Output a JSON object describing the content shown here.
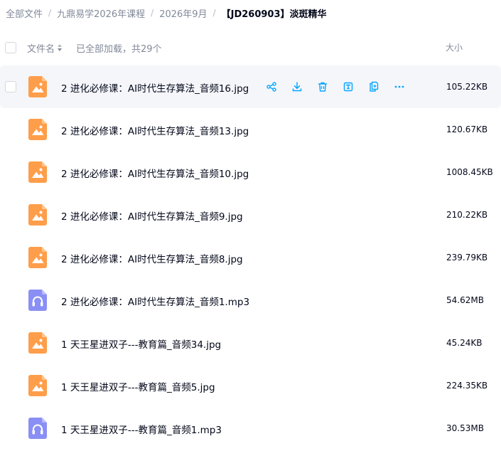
{
  "breadcrumb": [
    "全部文件",
    "九鼎易学2026年课程",
    "2026年9月",
    "【JD260903】淡斑精华"
  ],
  "header": {
    "name_label": "文件名",
    "loaded_info": "已全部加载，共29个",
    "size_label": "大小"
  },
  "colors": {
    "accent": "#06a7ff",
    "image_icon": "#ff9e4a",
    "audio_icon": "#8a8ff5",
    "text_primary": "#03081a",
    "text_secondary": "#818999"
  },
  "files": [
    {
      "name": "2 进化必修课：AI时代生存算法_音频16.jpg",
      "size": "105.22KB",
      "type": "image",
      "icon": "image-file-icon"
    },
    {
      "name": "2 进化必修课：AI时代生存算法_音频13.jpg",
      "size": "120.67KB",
      "type": "image",
      "icon": "image-file-icon"
    },
    {
      "name": "2 进化必修课：AI时代生存算法_音频10.jpg",
      "size": "1008.45KB",
      "type": "image",
      "icon": "image-file-icon"
    },
    {
      "name": "2 进化必修课：AI时代生存算法_音频9.jpg",
      "size": "210.22KB",
      "type": "image",
      "icon": "image-file-icon"
    },
    {
      "name": "2 进化必修课：AI时代生存算法_音频8.jpg",
      "size": "239.79KB",
      "type": "image",
      "icon": "image-file-icon"
    },
    {
      "name": "2 进化必修课：AI时代生存算法_音频1.mp3",
      "size": "54.62MB",
      "type": "audio",
      "icon": "audio-file-icon"
    },
    {
      "name": "1 天王星进双子---教育篇_音频34.jpg",
      "size": "45.24KB",
      "type": "image",
      "icon": "image-file-icon"
    },
    {
      "name": "1 天王星进双子---教育篇_音频5.jpg",
      "size": "224.35KB",
      "type": "image",
      "icon": "image-file-icon"
    },
    {
      "name": "1 天王星进双子---教育篇_音频1.mp3",
      "size": "30.53MB",
      "type": "audio",
      "icon": "audio-file-icon"
    }
  ],
  "row_actions": [
    "share-icon",
    "download-icon",
    "delete-icon",
    "rename-icon",
    "copy-icon",
    "more-icon"
  ]
}
